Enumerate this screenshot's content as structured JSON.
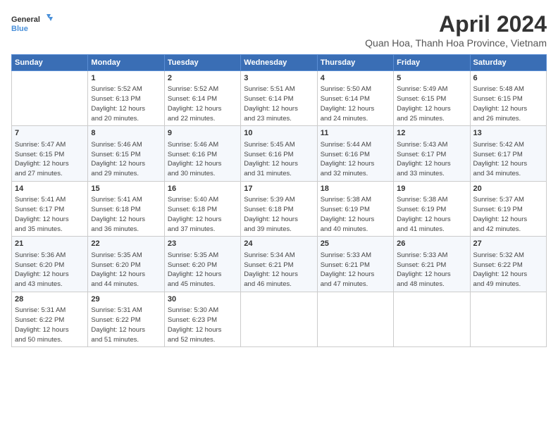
{
  "header": {
    "logo_line1": "General",
    "logo_line2": "Blue",
    "title": "April 2024",
    "subtitle": "Quan Hoa, Thanh Hoa Province, Vietnam"
  },
  "columns": [
    "Sunday",
    "Monday",
    "Tuesday",
    "Wednesday",
    "Thursday",
    "Friday",
    "Saturday"
  ],
  "weeks": [
    [
      {
        "num": "",
        "info": ""
      },
      {
        "num": "1",
        "info": "Sunrise: 5:52 AM\nSunset: 6:13 PM\nDaylight: 12 hours\nand 20 minutes."
      },
      {
        "num": "2",
        "info": "Sunrise: 5:52 AM\nSunset: 6:14 PM\nDaylight: 12 hours\nand 22 minutes."
      },
      {
        "num": "3",
        "info": "Sunrise: 5:51 AM\nSunset: 6:14 PM\nDaylight: 12 hours\nand 23 minutes."
      },
      {
        "num": "4",
        "info": "Sunrise: 5:50 AM\nSunset: 6:14 PM\nDaylight: 12 hours\nand 24 minutes."
      },
      {
        "num": "5",
        "info": "Sunrise: 5:49 AM\nSunset: 6:15 PM\nDaylight: 12 hours\nand 25 minutes."
      },
      {
        "num": "6",
        "info": "Sunrise: 5:48 AM\nSunset: 6:15 PM\nDaylight: 12 hours\nand 26 minutes."
      }
    ],
    [
      {
        "num": "7",
        "info": "Sunrise: 5:47 AM\nSunset: 6:15 PM\nDaylight: 12 hours\nand 27 minutes."
      },
      {
        "num": "8",
        "info": "Sunrise: 5:46 AM\nSunset: 6:15 PM\nDaylight: 12 hours\nand 29 minutes."
      },
      {
        "num": "9",
        "info": "Sunrise: 5:46 AM\nSunset: 6:16 PM\nDaylight: 12 hours\nand 30 minutes."
      },
      {
        "num": "10",
        "info": "Sunrise: 5:45 AM\nSunset: 6:16 PM\nDaylight: 12 hours\nand 31 minutes."
      },
      {
        "num": "11",
        "info": "Sunrise: 5:44 AM\nSunset: 6:16 PM\nDaylight: 12 hours\nand 32 minutes."
      },
      {
        "num": "12",
        "info": "Sunrise: 5:43 AM\nSunset: 6:17 PM\nDaylight: 12 hours\nand 33 minutes."
      },
      {
        "num": "13",
        "info": "Sunrise: 5:42 AM\nSunset: 6:17 PM\nDaylight: 12 hours\nand 34 minutes."
      }
    ],
    [
      {
        "num": "14",
        "info": "Sunrise: 5:41 AM\nSunset: 6:17 PM\nDaylight: 12 hours\nand 35 minutes."
      },
      {
        "num": "15",
        "info": "Sunrise: 5:41 AM\nSunset: 6:18 PM\nDaylight: 12 hours\nand 36 minutes."
      },
      {
        "num": "16",
        "info": "Sunrise: 5:40 AM\nSunset: 6:18 PM\nDaylight: 12 hours\nand 37 minutes."
      },
      {
        "num": "17",
        "info": "Sunrise: 5:39 AM\nSunset: 6:18 PM\nDaylight: 12 hours\nand 39 minutes."
      },
      {
        "num": "18",
        "info": "Sunrise: 5:38 AM\nSunset: 6:19 PM\nDaylight: 12 hours\nand 40 minutes."
      },
      {
        "num": "19",
        "info": "Sunrise: 5:38 AM\nSunset: 6:19 PM\nDaylight: 12 hours\nand 41 minutes."
      },
      {
        "num": "20",
        "info": "Sunrise: 5:37 AM\nSunset: 6:19 PM\nDaylight: 12 hours\nand 42 minutes."
      }
    ],
    [
      {
        "num": "21",
        "info": "Sunrise: 5:36 AM\nSunset: 6:20 PM\nDaylight: 12 hours\nand 43 minutes."
      },
      {
        "num": "22",
        "info": "Sunrise: 5:35 AM\nSunset: 6:20 PM\nDaylight: 12 hours\nand 44 minutes."
      },
      {
        "num": "23",
        "info": "Sunrise: 5:35 AM\nSunset: 6:20 PM\nDaylight: 12 hours\nand 45 minutes."
      },
      {
        "num": "24",
        "info": "Sunrise: 5:34 AM\nSunset: 6:21 PM\nDaylight: 12 hours\nand 46 minutes."
      },
      {
        "num": "25",
        "info": "Sunrise: 5:33 AM\nSunset: 6:21 PM\nDaylight: 12 hours\nand 47 minutes."
      },
      {
        "num": "26",
        "info": "Sunrise: 5:33 AM\nSunset: 6:21 PM\nDaylight: 12 hours\nand 48 minutes."
      },
      {
        "num": "27",
        "info": "Sunrise: 5:32 AM\nSunset: 6:22 PM\nDaylight: 12 hours\nand 49 minutes."
      }
    ],
    [
      {
        "num": "28",
        "info": "Sunrise: 5:31 AM\nSunset: 6:22 PM\nDaylight: 12 hours\nand 50 minutes."
      },
      {
        "num": "29",
        "info": "Sunrise: 5:31 AM\nSunset: 6:22 PM\nDaylight: 12 hours\nand 51 minutes."
      },
      {
        "num": "30",
        "info": "Sunrise: 5:30 AM\nSunset: 6:23 PM\nDaylight: 12 hours\nand 52 minutes."
      },
      {
        "num": "",
        "info": ""
      },
      {
        "num": "",
        "info": ""
      },
      {
        "num": "",
        "info": ""
      },
      {
        "num": "",
        "info": ""
      }
    ]
  ]
}
